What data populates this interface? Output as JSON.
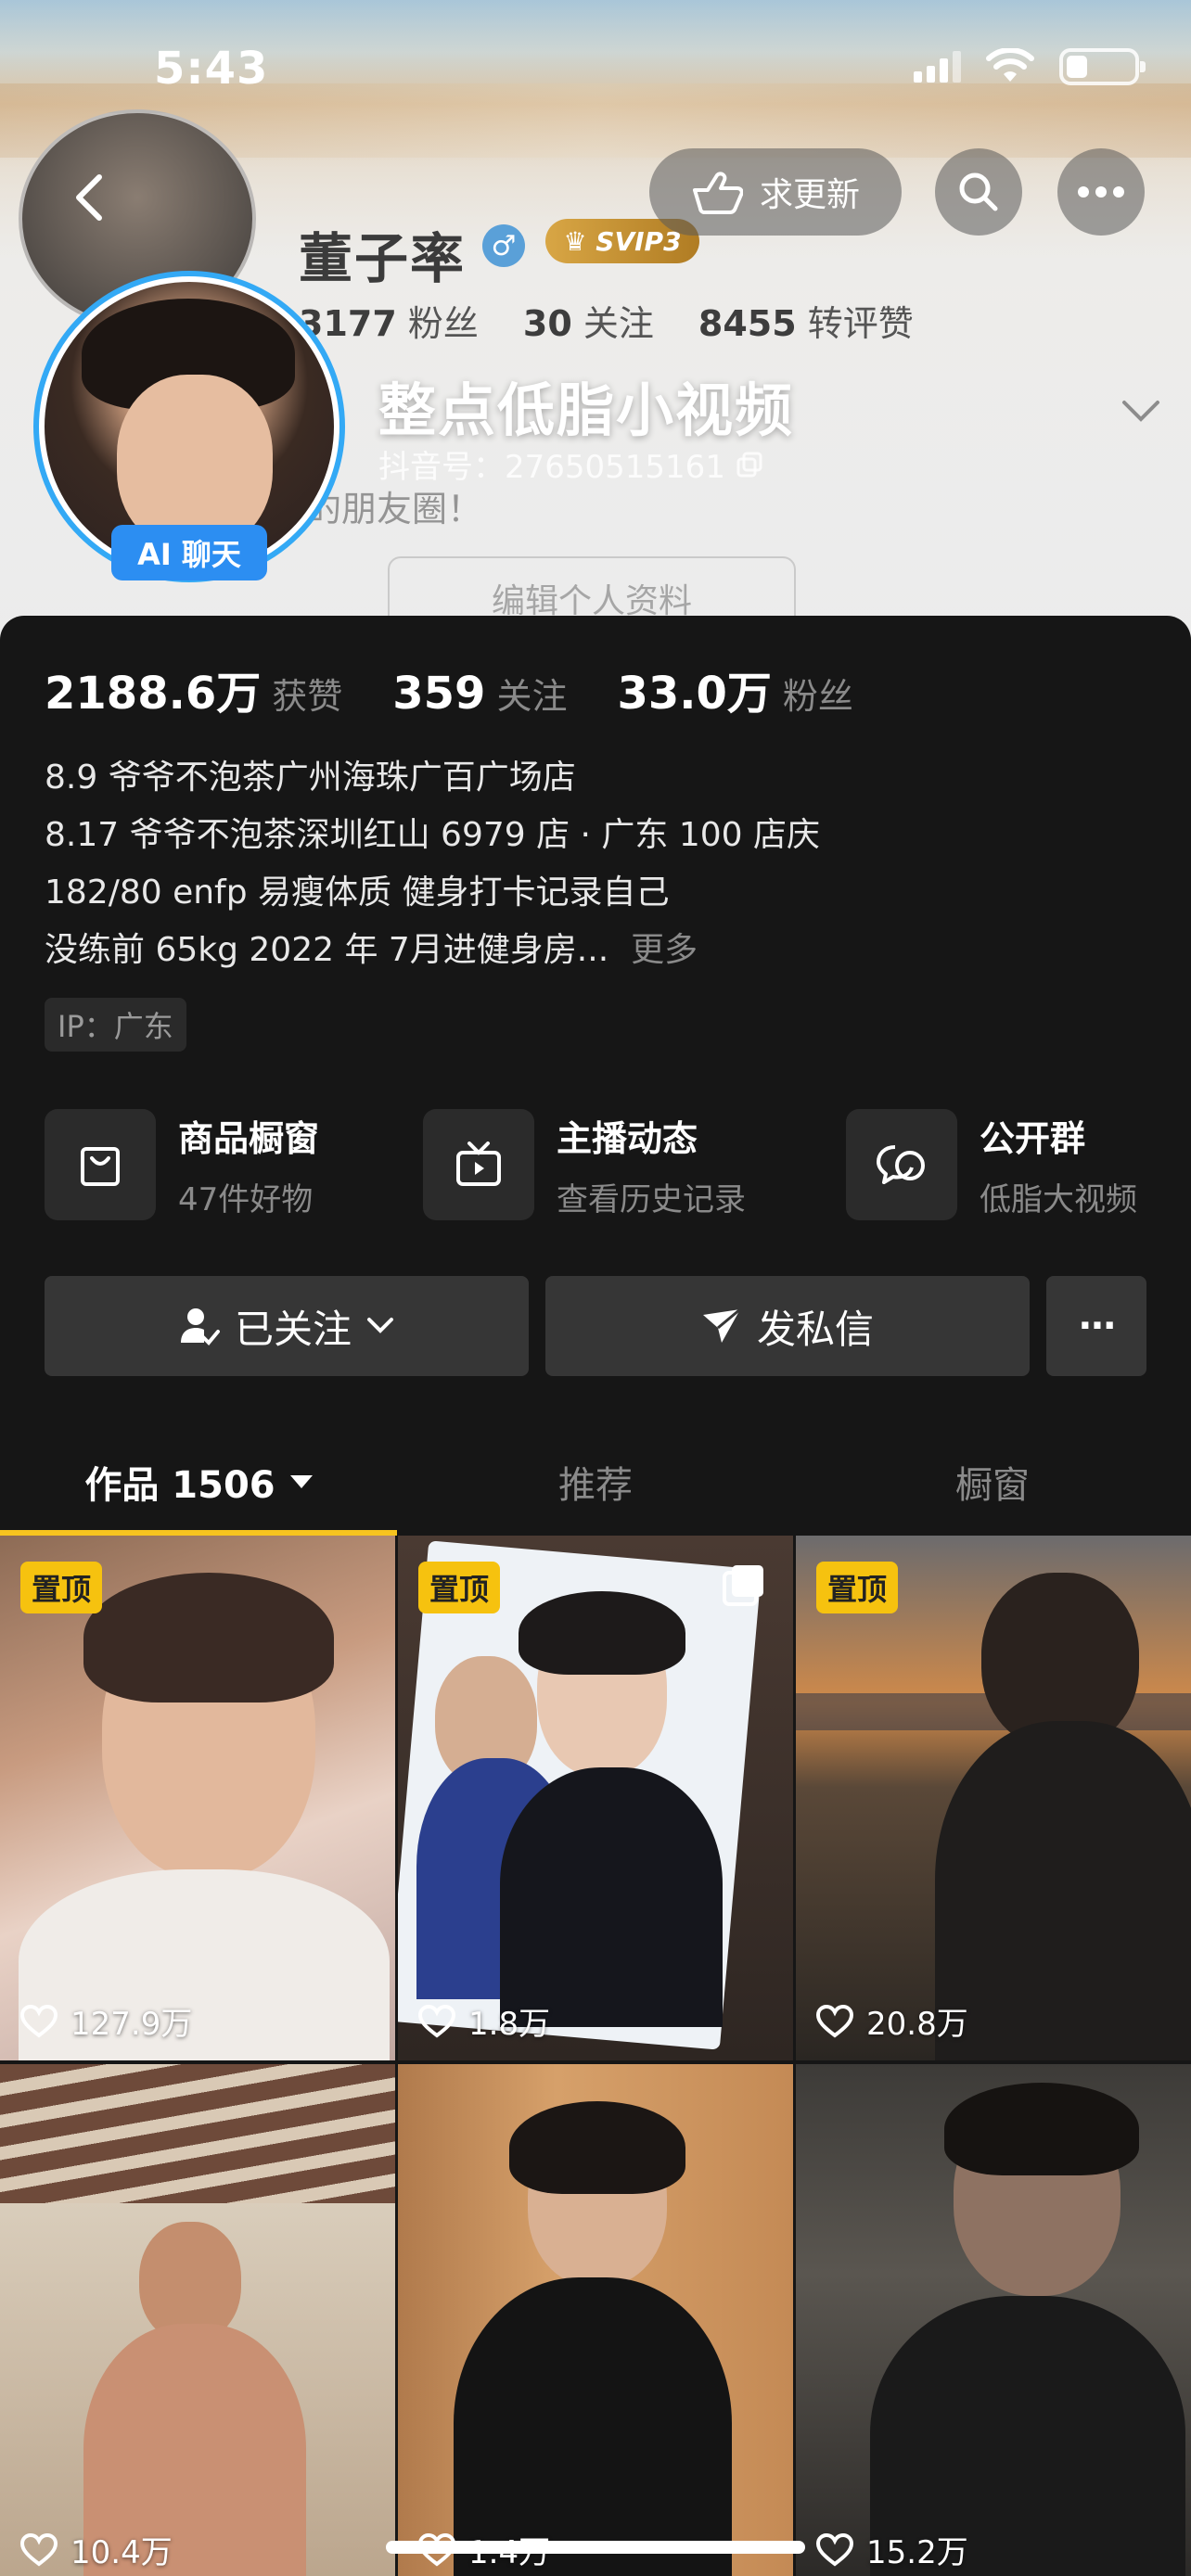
{
  "status_bar": {
    "time": "5:43"
  },
  "header": {
    "request_update_label": "求更新",
    "channel_title": "整点低脂小视频",
    "douyin_id": "抖音号：27650515161",
    "ai_chat_label": "AI 聊天"
  },
  "ghost_profile": {
    "name": "董子率",
    "gender": "♂",
    "vip": "SVIP3",
    "stats": [
      {
        "num": "3177",
        "label": "粉丝"
      },
      {
        "num": "30",
        "label": "关注"
      },
      {
        "num": "8455",
        "label": "转评赞"
      }
    ],
    "bio_fragment": "的朋友圈！",
    "edit_label": "编辑个人资料"
  },
  "stats": [
    {
      "num": "2188.6万",
      "label": "获赞"
    },
    {
      "num": "359",
      "label": "关注"
    },
    {
      "num": "33.0万",
      "label": "粉丝"
    }
  ],
  "bio": {
    "lines": [
      "8.9 爷爷不泡茶广州海珠广百广场店",
      "8.17 爷爷不泡茶深圳红山 6979 店 · 广东 100 店庆",
      "182/80  enfp  易瘦体质 健身打卡记录自己",
      "没练前 65kg 2022 年 7月进健身房..."
    ],
    "more": "更多",
    "ip": "IP：广东"
  },
  "features": [
    {
      "title": "商品橱窗",
      "sub": "47件好物",
      "icon": "shopping-bag-icon"
    },
    {
      "title": "主播动态",
      "sub": "查看历史记录",
      "icon": "tv-icon"
    },
    {
      "title": "公开群",
      "sub": "低脂大视频",
      "icon": "chat-bubbles-icon"
    }
  ],
  "actions": {
    "following": "已关注",
    "message": "发私信",
    "more": "···"
  },
  "tabs": [
    {
      "label": "作品 1506",
      "active": true
    },
    {
      "label": "推荐",
      "active": false
    },
    {
      "label": "橱窗",
      "active": false
    }
  ],
  "videos": [
    {
      "pinned": "置顶",
      "likes": "127.9万"
    },
    {
      "pinned": "置顶",
      "likes": "1.8万"
    },
    {
      "pinned": "置顶",
      "likes": "20.8万"
    },
    {
      "pinned": "",
      "likes": "10.4万"
    },
    {
      "pinned": "",
      "likes": "1.4万"
    },
    {
      "pinned": "",
      "likes": "15.2万"
    }
  ],
  "colors": {
    "accent_yellow": "#f6c20f",
    "avatar_ring": "#33a9f5",
    "panel_bg": "#161616"
  }
}
